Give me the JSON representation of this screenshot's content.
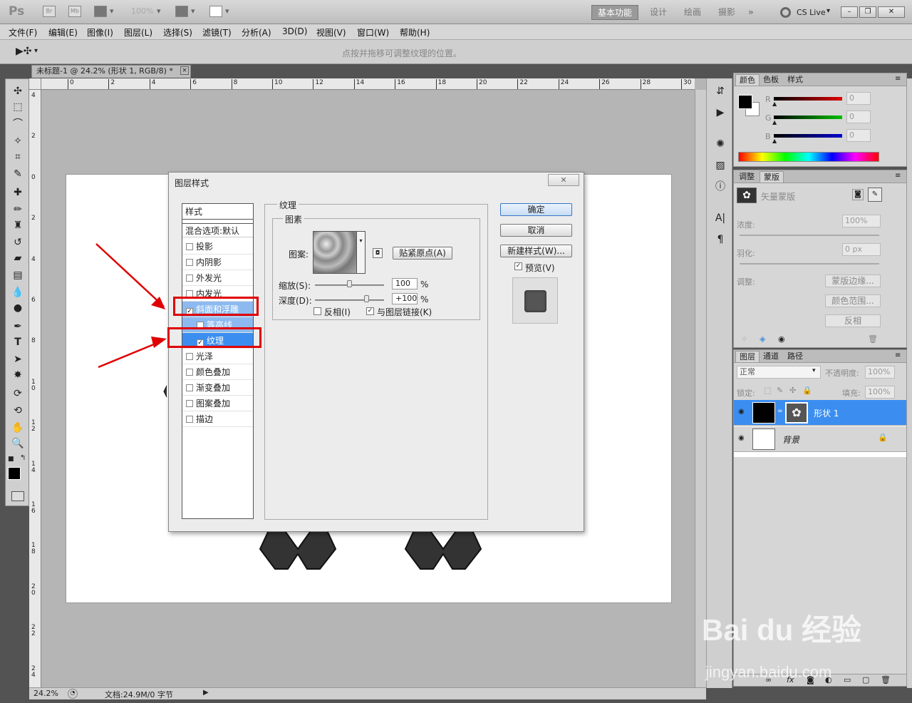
{
  "titlebar": {
    "logo": "Ps",
    "btn_br": "Br",
    "btn_mb": "Mb",
    "zoom": "100%",
    "workspaces": [
      "基本功能",
      "设计",
      "绘画",
      "摄影"
    ],
    "cslive": "CS Live",
    "chevron": "»"
  },
  "menu": [
    "文件(F)",
    "编辑(E)",
    "图像(I)",
    "图层(L)",
    "选择(S)",
    "滤镜(T)",
    "分析(A)",
    "3D(D)",
    "视图(V)",
    "窗口(W)",
    "帮助(H)"
  ],
  "options": {
    "hint": "点按并拖移可调整纹理的位置。"
  },
  "document": {
    "tab_title": "未标题-1 @ 24.2% (形状 1, RGB/8) *",
    "close": "×"
  },
  "rulers": {
    "top": [
      "0",
      "2",
      "4",
      "6",
      "8",
      "10",
      "12",
      "14",
      "16",
      "18",
      "20",
      "22",
      "24",
      "26",
      "28",
      "30"
    ],
    "left": [
      "4",
      "2",
      "0",
      "2",
      "4",
      "6",
      "8",
      "1\n0",
      "1\n2",
      "1\n4",
      "1\n6",
      "1\n8",
      "2\n0",
      "2\n2",
      "2\n4"
    ]
  },
  "status": {
    "zoom": "24.2%",
    "doc": "文档:24.9M/0 字节"
  },
  "dialog": {
    "title": "图层样式",
    "close": "✕",
    "styles_header": "样式",
    "blend_options": "混合选项:默认",
    "styles": [
      {
        "label": "投影",
        "checked": false
      },
      {
        "label": "内阴影",
        "checked": false
      },
      {
        "label": "外发光",
        "checked": false
      },
      {
        "label": "内发光",
        "checked": false
      },
      {
        "label": "斜面和浮雕",
        "checked": true
      },
      {
        "label": "等高线",
        "checked": false
      },
      {
        "label": "纹理",
        "checked": true
      },
      {
        "label": "光泽",
        "checked": false
      },
      {
        "label": "颜色叠加",
        "checked": false
      },
      {
        "label": "渐变叠加",
        "checked": false
      },
      {
        "label": "图案叠加",
        "checked": false
      },
      {
        "label": "描边",
        "checked": false
      }
    ],
    "section_title": "纹理",
    "group_title": "图素",
    "pattern_label": "图案:",
    "snap_button": "贴紧原点(A)",
    "scale_label": "缩放(S):",
    "scale_value": "100",
    "scale_unit": "%",
    "scale_fraction": 0.5,
    "depth_label": "深度(D):",
    "depth_value": "+100",
    "depth_unit": "%",
    "depth_fraction": 0.75,
    "invert_label": "反相(I)",
    "invert_checked": false,
    "link_label": "与图层链接(K)",
    "link_checked": true,
    "ok": "确定",
    "cancel": "取消",
    "new_style": "新建样式(W)...",
    "preview_label": "预览(V)",
    "preview_checked": true
  },
  "color_panel": {
    "tabs": [
      "颜色",
      "色板",
      "样式"
    ],
    "channels": [
      {
        "name": "R",
        "value": "0",
        "color": "#e00000"
      },
      {
        "name": "G",
        "value": "0",
        "color": "#00c000"
      },
      {
        "name": "B",
        "value": "0",
        "color": "#0000d0"
      }
    ]
  },
  "masks_panel": {
    "tabs": [
      "调整",
      "蒙版"
    ],
    "vector_mask": "矢量蒙版",
    "density_label": "浓度:",
    "density_value": "100%",
    "feather_label": "羽化:",
    "feather_value": "0 px",
    "refine_label": "调整:",
    "mask_edge": "蒙版边缘...",
    "color_range": "颜色范围...",
    "invert": "反相"
  },
  "layers_panel": {
    "tabs": [
      "图层",
      "通道",
      "路径"
    ],
    "blend_mode": "正常",
    "opacity_label": "不透明度:",
    "opacity": "100%",
    "lock_label": "锁定:",
    "fill_label": "填充:",
    "fill": "100%",
    "layers": [
      {
        "name": "形状 1",
        "selected": true
      },
      {
        "name": "背景",
        "selected": false
      }
    ]
  },
  "watermark": {
    "brand": "Bai du 经验",
    "url": "jingyan.baidu.com"
  }
}
